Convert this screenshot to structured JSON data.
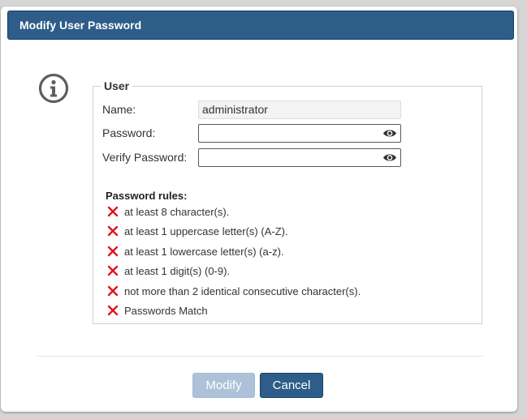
{
  "dialog": {
    "title": "Modify User Password",
    "info_icon": "info-circle-icon"
  },
  "user_section": {
    "legend": "User",
    "name_label": "Name:",
    "name_value": "administrator",
    "password_label": "Password:",
    "password_value": "",
    "verify_label": "Verify Password:",
    "verify_value": "",
    "eye_icon": "eye-icon"
  },
  "rules": {
    "title": "Password rules:",
    "status_icon": "x-mark-icon",
    "items": [
      {
        "text": "at least 8 character(s).",
        "met": false
      },
      {
        "text": "at least 1 uppercase letter(s) (A-Z).",
        "met": false
      },
      {
        "text": "at least 1 lowercase letter(s) (a-z).",
        "met": false
      },
      {
        "text": "at least 1 digit(s) (0-9).",
        "met": false
      },
      {
        "text": "not more than 2 identical consecutive character(s).",
        "met": false
      },
      {
        "text": "Passwords Match",
        "met": false
      }
    ]
  },
  "buttons": {
    "modify_label": "Modify",
    "modify_enabled": false,
    "cancel_label": "Cancel"
  },
  "colors": {
    "titlebar": "#2d5d88",
    "button_primary": "#2d5d88",
    "button_disabled": "#adc2d9",
    "rule_fail": "#e0141e"
  }
}
